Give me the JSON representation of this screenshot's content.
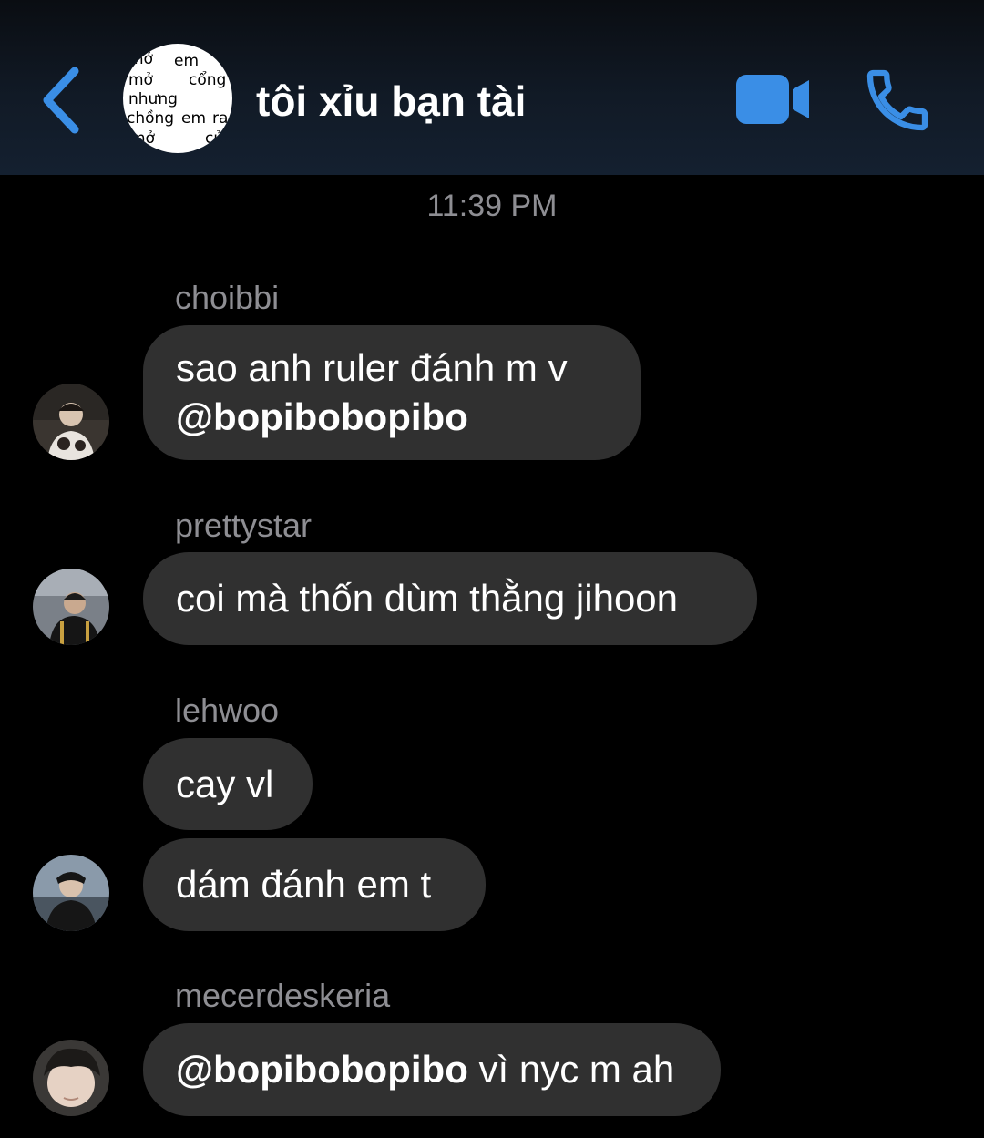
{
  "header": {
    "title": "tôi xỉu bạn tài",
    "back_icon": "chevron-left-icon",
    "video_icon": "video-camera-icon",
    "call_icon": "phone-icon",
    "accent_color": "#3a8ee6",
    "group_avatar_words": [
      "mở",
      "em",
      "mở",
      "cổng",
      "nhưng",
      "chồng",
      "em",
      "ra",
      "mở",
      "cửa"
    ]
  },
  "timestamp": "11:39 PM",
  "messages": [
    {
      "sender": "choibbi",
      "bubbles": [
        {
          "line1": "sao anh ruler đánh m v",
          "mention": "@bopibobopibo"
        }
      ]
    },
    {
      "sender": "prettystar",
      "bubbles": [
        {
          "text": "coi mà thốn dùm thằng jihoon"
        }
      ]
    },
    {
      "sender": "lehwoo",
      "bubbles": [
        {
          "text": "cay vl"
        },
        {
          "text": "dám đánh em t"
        }
      ]
    },
    {
      "sender": "mecerdeskeria",
      "bubbles": [
        {
          "mention": "@bopibobopibo",
          "text": " vì nyc m ah"
        }
      ]
    }
  ]
}
